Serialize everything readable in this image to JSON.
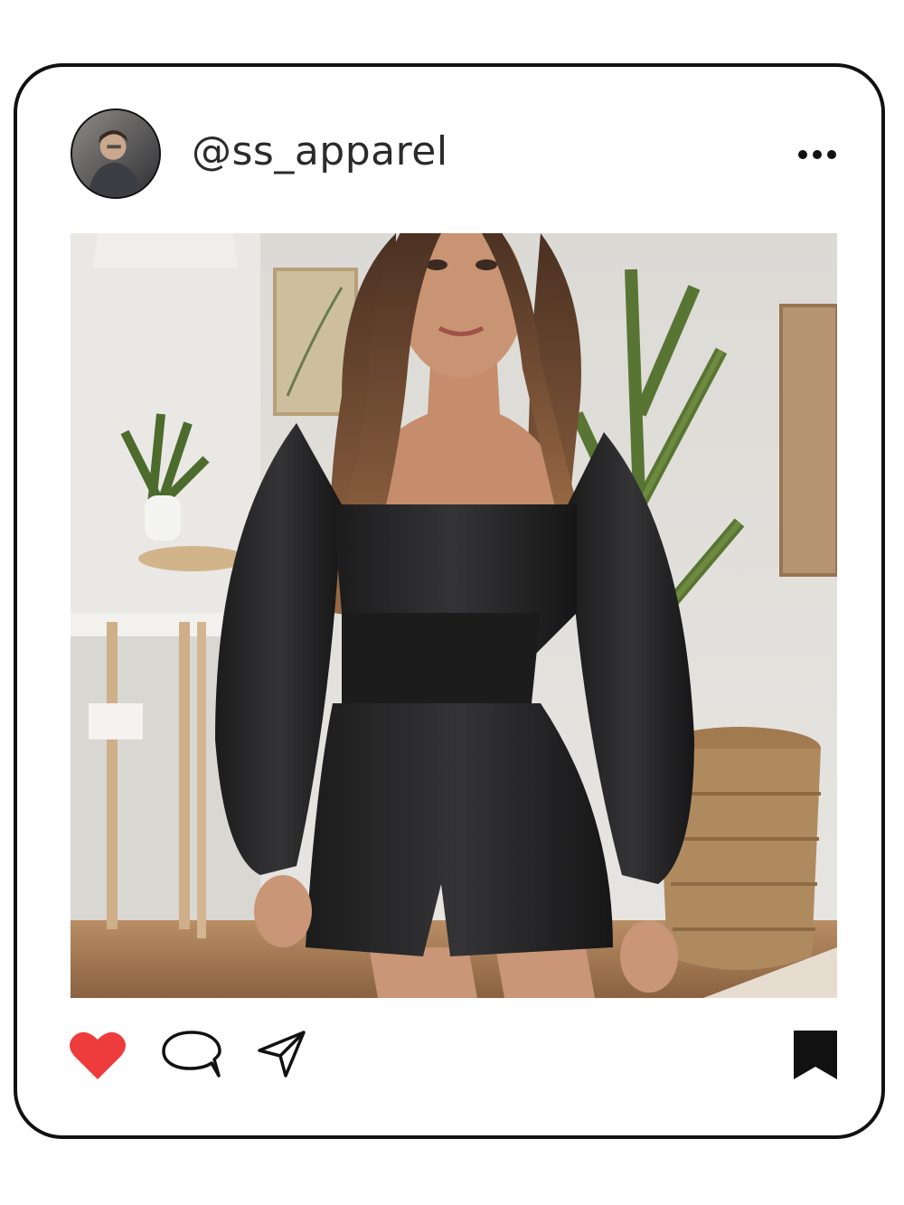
{
  "post": {
    "username": "@ss_apparel"
  },
  "icons": {
    "avatar": "profile-photo",
    "more": "more-horizontal-icon",
    "like": "heart-icon",
    "comment": "comment-bubble-icon",
    "share": "paper-plane-icon",
    "save": "bookmark-icon"
  },
  "colors": {
    "frame": "#111111",
    "like": "#ee3b3b",
    "text": "#2b2b2b"
  }
}
